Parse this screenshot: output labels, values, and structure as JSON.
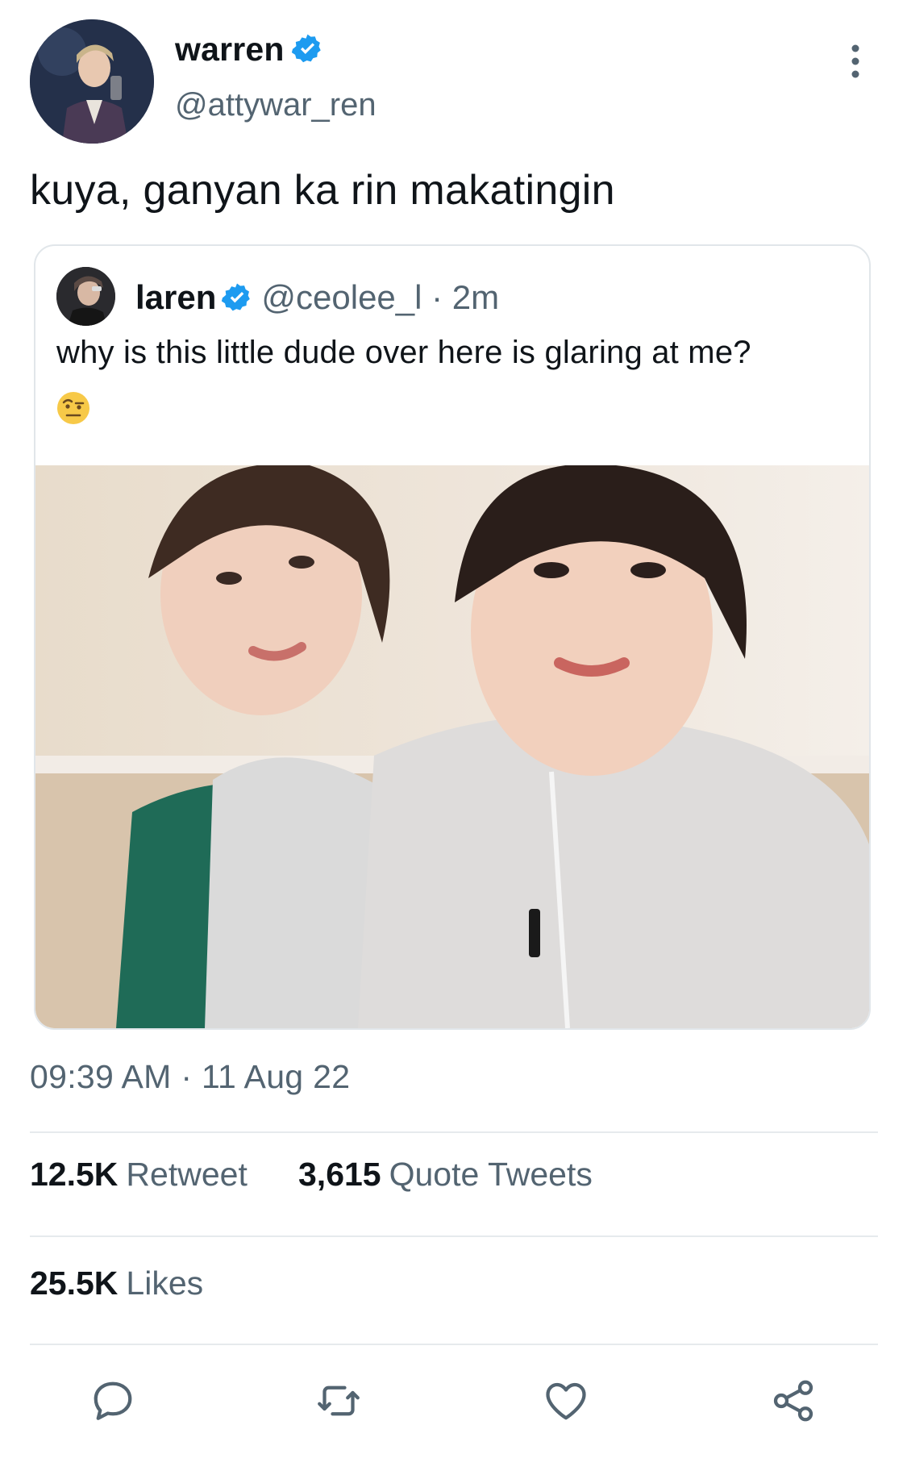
{
  "author": {
    "name": "warren",
    "handle": "@attywar_ren",
    "verified_icon": "verified-badge-icon",
    "avatar_icon": "avatar"
  },
  "tweet": {
    "text": "kuya, ganyan ka rin makatingin"
  },
  "quoted": {
    "name": "laren",
    "handle": "@ceolee_l · 2m",
    "text": "why is this little dude over here is glaring at me?",
    "emoji_icon": "raised-eyebrow-emoji-icon",
    "image_icon": "two-kids-photo"
  },
  "meta": {
    "timestamp": "09:39 AM · 11 Aug 22"
  },
  "stats": {
    "retweets_count": "12.5K",
    "retweets_label": "Retweet",
    "quotes_count": "3,615",
    "quotes_label": "Quote Tweets",
    "likes_count": "25.5K",
    "likes_label": "Likes"
  },
  "actions": [
    "reply-icon",
    "retweet-icon",
    "like-icon",
    "share-icon"
  ],
  "colors": {
    "verified": "#1d9bf0",
    "secondary_text": "#536471",
    "divider": "#e6eaed",
    "border": "#e1e6ea"
  }
}
